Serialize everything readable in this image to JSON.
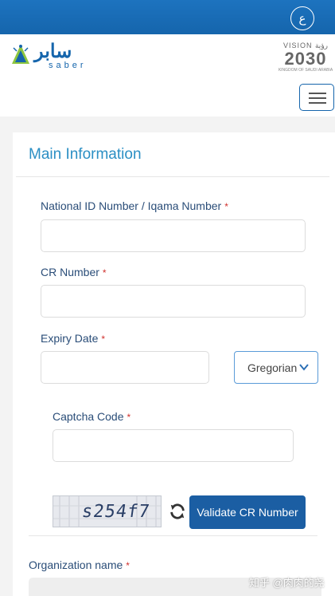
{
  "topbar": {
    "language_button": "ع"
  },
  "header": {
    "logo_arabic": "سابر",
    "logo_english": "saber",
    "vision_word": "VISION رؤية",
    "vision_year": "2030",
    "vision_kingdom": "KINGDOM OF SAUDI ARABIA"
  },
  "form": {
    "section_title": "Main Information",
    "national_id_label": "National ID Number / Iqama Number",
    "cr_number_label": "CR Number",
    "expiry_date_label": "Expiry Date",
    "calendar_select": "Gregorian",
    "captcha_label": "Captcha Code",
    "captcha_text": "s254f7",
    "validate_button": "Validate CR Number",
    "organization_label": "Organization name",
    "required_mark": "*"
  },
  "watermark": "知乎 @肉肉的尧",
  "colors": {
    "brand_blue": "#1565ac",
    "title_blue": "#2b8fc4",
    "required_red": "#d0312d"
  }
}
